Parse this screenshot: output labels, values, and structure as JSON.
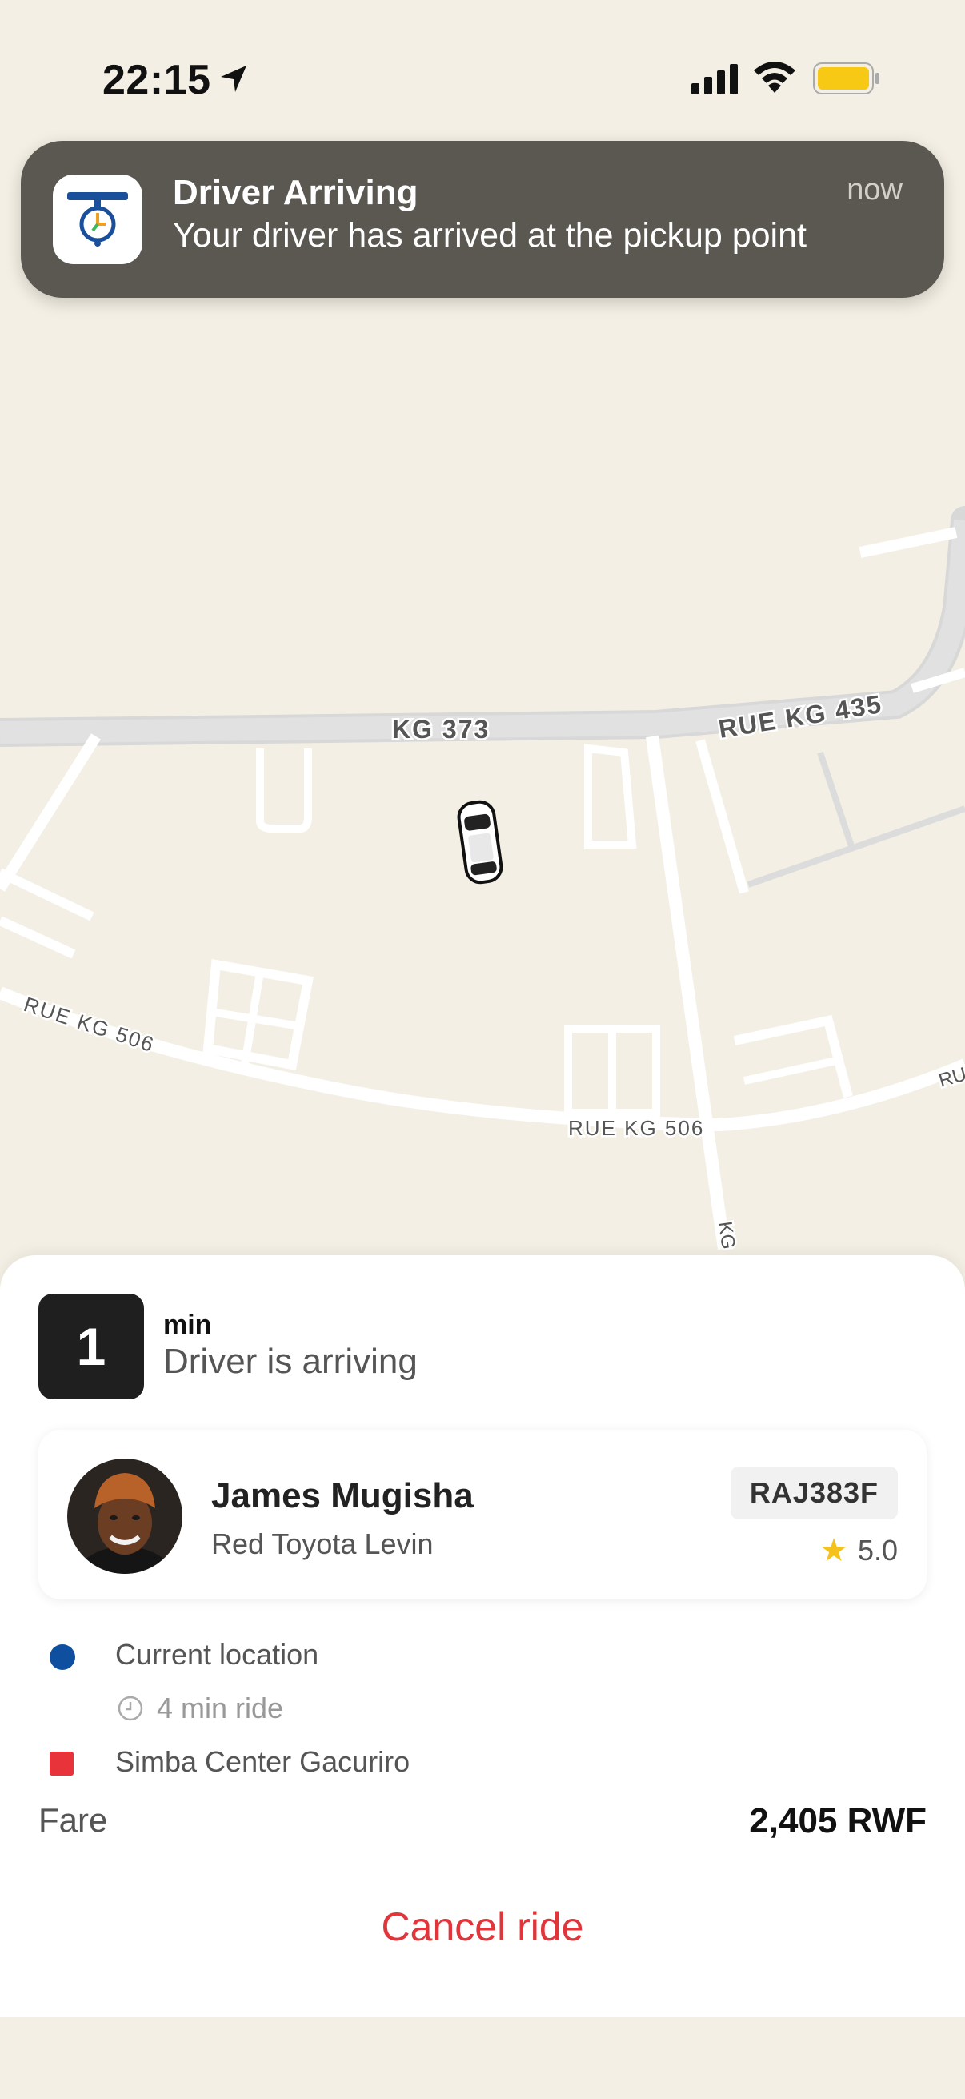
{
  "status_bar": {
    "time": "22:15",
    "icons": [
      "location-arrow-icon",
      "signal-icon",
      "wifi-icon",
      "battery-icon"
    ]
  },
  "notification": {
    "app_icon": "ride-app-icon",
    "title": "Driver Arriving",
    "body": "Your driver has arrived at the pickup point",
    "time": "now"
  },
  "map": {
    "roads": [
      "KG 373",
      "RUE KG 435",
      "RUE KG 506",
      "RUE KG 506",
      "KG",
      "RU"
    ],
    "vehicle_icon": "car-icon"
  },
  "eta": {
    "value": "1",
    "unit": "min",
    "status": "Driver is arriving"
  },
  "driver": {
    "name": "James Mugisha",
    "car": "Red Toyota Levin",
    "plate": "RAJ383F",
    "rating": "5.0",
    "rating_icon": "star-icon"
  },
  "route": {
    "pickup": "Current location",
    "duration": "4 min ride",
    "destination": "Simba Center Gacuriro"
  },
  "fare": {
    "label": "Fare",
    "value": "2,405 RWF"
  },
  "actions": {
    "cancel_label": "Cancel ride"
  },
  "colors": {
    "accent_blue": "#0e4fa0",
    "danger_red": "#e0353b",
    "star_yellow": "#f5c21b",
    "map_bg": "#f3efe4"
  }
}
